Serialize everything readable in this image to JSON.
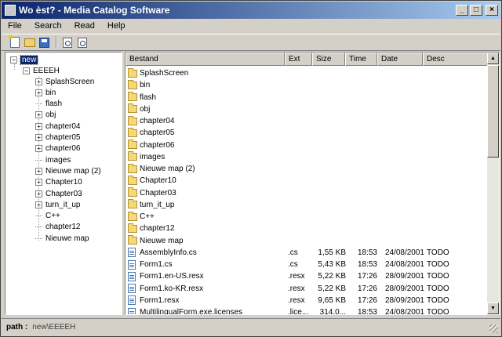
{
  "window": {
    "title": "Wo èst? - Media Catalog Software",
    "controls": [
      "_",
      "□",
      "×"
    ]
  },
  "menu": [
    "File",
    "Search",
    "Read",
    "Help"
  ],
  "toolbar": {
    "icons": [
      "new-catalog-icon",
      "open-folder-icon",
      "save-icon",
      "search-file-icon",
      "find-icon"
    ]
  },
  "tree": {
    "root": "new",
    "child": "EEEEH",
    "items": [
      {
        "label": "SplashScreen",
        "expandable": true
      },
      {
        "label": "bin",
        "expandable": true
      },
      {
        "label": "flash",
        "expandable": false
      },
      {
        "label": "obj",
        "expandable": true
      },
      {
        "label": "chapter04",
        "expandable": true
      },
      {
        "label": "chapter05",
        "expandable": true
      },
      {
        "label": "chapter06",
        "expandable": true
      },
      {
        "label": "images",
        "expandable": false
      },
      {
        "label": "Nieuwe map (2)",
        "expandable": true
      },
      {
        "label": "Chapter10",
        "expandable": true
      },
      {
        "label": "Chapter03",
        "expandable": true
      },
      {
        "label": "turn_it_up",
        "expandable": true
      },
      {
        "label": "C++",
        "expandable": false
      },
      {
        "label": "chapter12",
        "expandable": false
      },
      {
        "label": "Nieuwe map",
        "expandable": false
      }
    ]
  },
  "list": {
    "columns": [
      "Bestand",
      "Ext",
      "Size",
      "Time",
      "Date",
      "Desc"
    ],
    "rows": [
      {
        "type": "folder",
        "name": "SplashScreen"
      },
      {
        "type": "folder",
        "name": "bin"
      },
      {
        "type": "folder",
        "name": "flash"
      },
      {
        "type": "folder",
        "name": "obj"
      },
      {
        "type": "folder",
        "name": "chapter04"
      },
      {
        "type": "folder",
        "name": "chapter05"
      },
      {
        "type": "folder",
        "name": "chapter06"
      },
      {
        "type": "folder",
        "name": "images"
      },
      {
        "type": "folder",
        "name": "Nieuwe map (2)"
      },
      {
        "type": "folder",
        "name": "Chapter10"
      },
      {
        "type": "folder",
        "name": "Chapter03"
      },
      {
        "type": "folder",
        "name": "turn_it_up"
      },
      {
        "type": "folder",
        "name": "C++"
      },
      {
        "type": "folder",
        "name": "chapter12"
      },
      {
        "type": "folder",
        "name": "Nieuwe map"
      },
      {
        "type": "file",
        "name": "AssemblyInfo.cs",
        "ext": ".cs",
        "size": "1,55 KB",
        "time": "18:53",
        "date": "24/08/2001",
        "desc": "TODO"
      },
      {
        "type": "file",
        "name": "Form1.cs",
        "ext": ".cs",
        "size": "5,43 KB",
        "time": "18:53",
        "date": "24/08/2001",
        "desc": "TODO"
      },
      {
        "type": "file",
        "name": "Form1.en-US.resx",
        "ext": ".resx",
        "size": "5,22 KB",
        "time": "17:26",
        "date": "28/09/2001",
        "desc": "TODO"
      },
      {
        "type": "file",
        "name": "Form1.ko-KR.resx",
        "ext": ".resx",
        "size": "5,22 KB",
        "time": "17:26",
        "date": "28/09/2001",
        "desc": "TODO"
      },
      {
        "type": "file",
        "name": "Form1.resx",
        "ext": ".resx",
        "size": "9,65 KB",
        "time": "17:26",
        "date": "28/09/2001",
        "desc": "TODO"
      },
      {
        "type": "file",
        "name": "MultilingualForm.exe.licenses",
        "ext": ".lice...",
        "size": "314,0...",
        "time": "18:53",
        "date": "24/08/2001",
        "desc": "TODO"
      }
    ]
  },
  "status": {
    "label": "path :",
    "value": "new\\EEEEH"
  }
}
